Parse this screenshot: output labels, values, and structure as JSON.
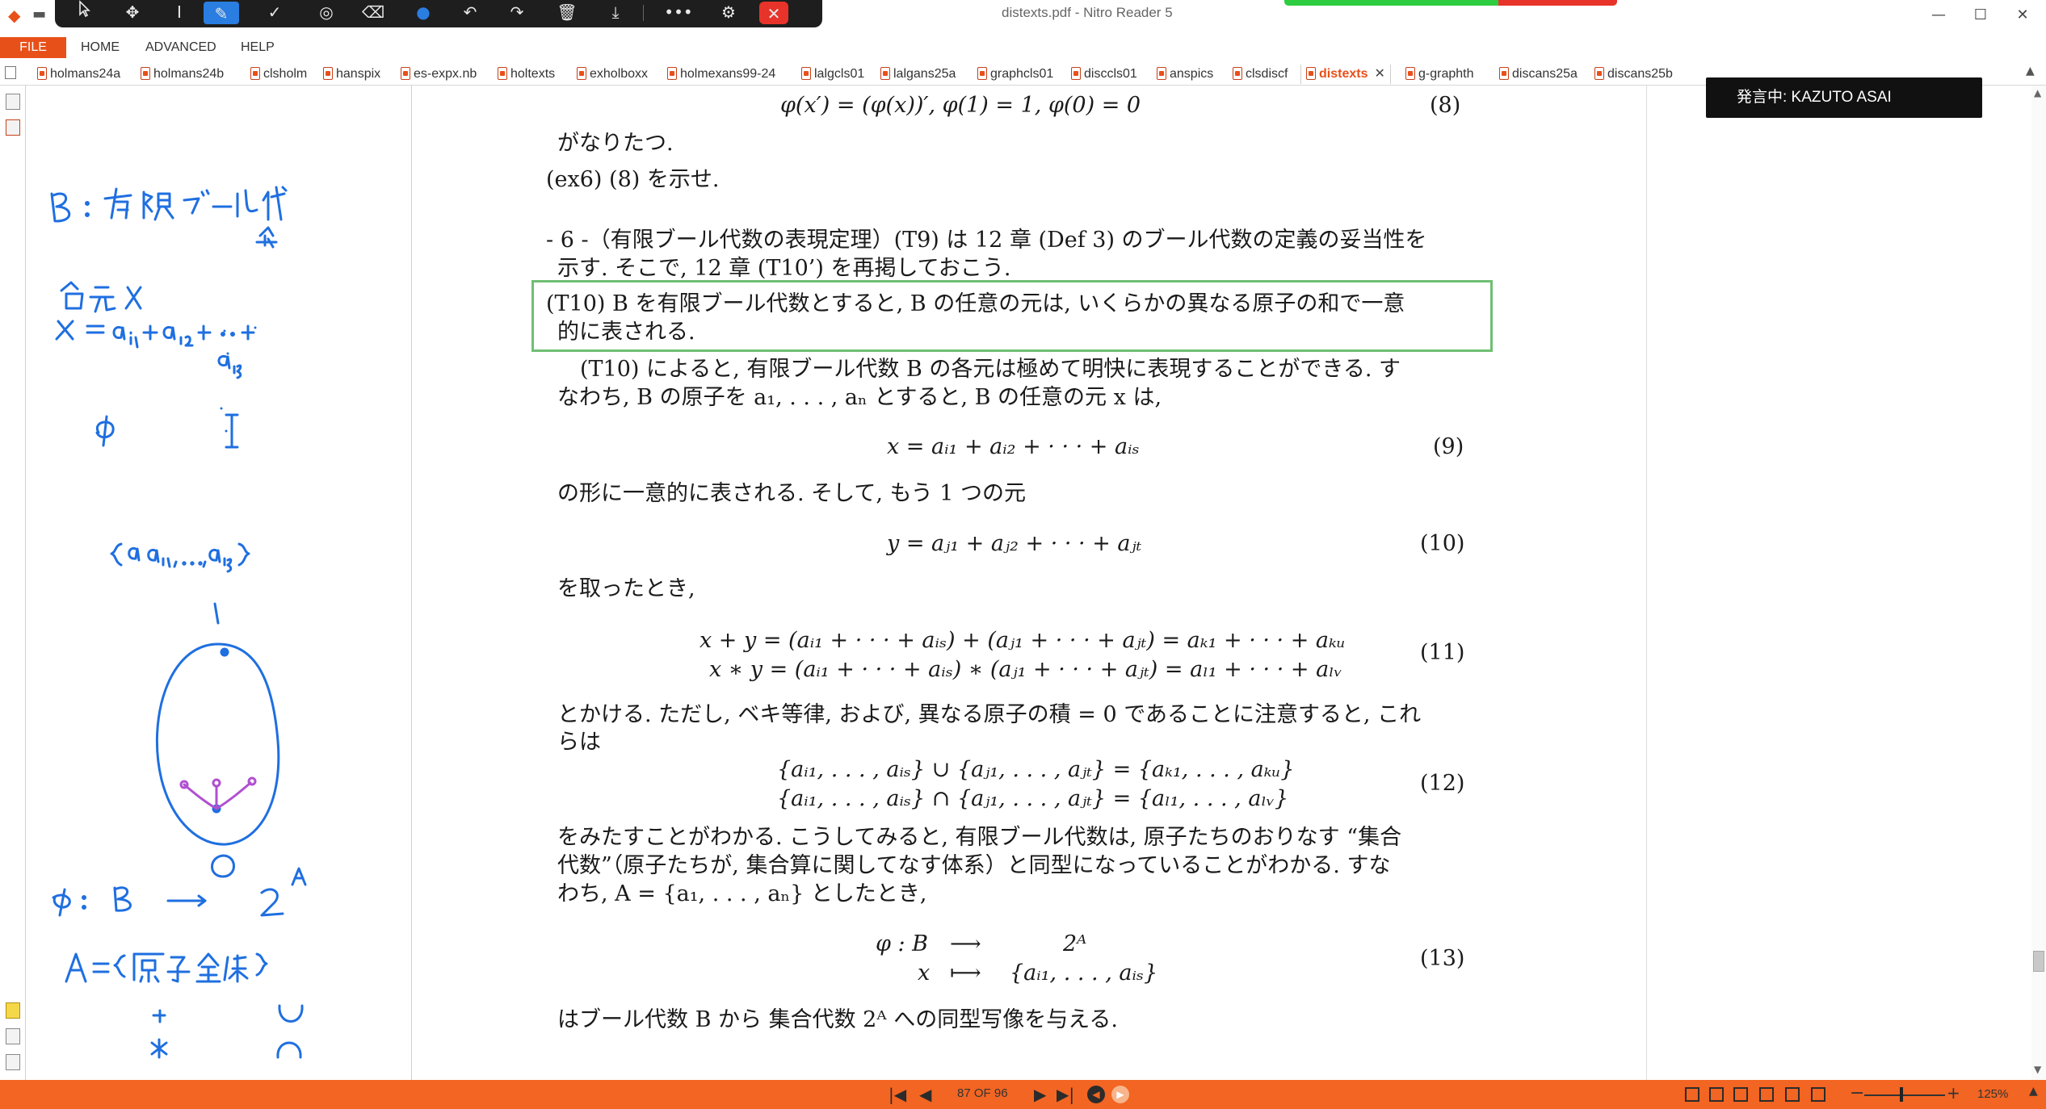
{
  "titlebar": {
    "window_title": "distexts.pdf - Nitro Reader 5",
    "minimize": "—",
    "maximize": "☐",
    "close": "✕"
  },
  "annotation_toolbar": {
    "icons": [
      "arrow-select",
      "move",
      "text-cursor",
      "pen",
      "check",
      "target",
      "eraser",
      "color-dot",
      "undo",
      "redo",
      "trash",
      "download",
      "more",
      "user-settings",
      "close"
    ]
  },
  "ribbon": {
    "file": "FILE",
    "home": "HOME",
    "advanced": "ADVANCED",
    "help": "HELP"
  },
  "doc_tabs": [
    {
      "label": "holmans24a"
    },
    {
      "label": "holmans24b"
    },
    {
      "label": "clsholm"
    },
    {
      "label": "hanspix"
    },
    {
      "label": "es-expx.nb"
    },
    {
      "label": "holtexts"
    },
    {
      "label": "exholboxx"
    },
    {
      "label": "holmexans99-24"
    },
    {
      "label": "lalgcls01"
    },
    {
      "label": "lalgans25a"
    },
    {
      "label": "graphcls01"
    },
    {
      "label": "disccls01"
    },
    {
      "label": "anspics"
    },
    {
      "label": "clsdiscf"
    },
    {
      "label": "distexts",
      "active": true
    },
    {
      "label": "g-graphth"
    },
    {
      "label": "discans25a"
    },
    {
      "label": "discans25b"
    }
  ],
  "speaker_popup": "発言中: KAZUTO ASAI",
  "document": {
    "eq8": "φ(x′) = (φ(x))′,       φ(1) = 1,       φ(0) = 0",
    "eq8_num": "(8)",
    "line_naritatsu": "がなりたつ.",
    "ex6": "(ex6)  (8) を示せ.",
    "sec6_line1": "- 6 -（有限ブール代数の表現定理）(T9) は 12 章 (Def 3) のブール代数の定義の妥当性を",
    "sec6_line2": "示す. そこで, 12 章 (T10’) を再掲しておこう.",
    "t10_line1": "(T10)  B を有限ブール代数とすると, B の任意の元は, いくらかの異なる原子の和で一意",
    "t10_line2": "的に表される.",
    "para1_line1": "(T10) によると, 有限ブール代数 B の各元は極めて明快に表現することができる. す",
    "para1_line2": "なわち, B の原子を  a₁, . . . , aₙ  とすると, B の任意の元 x  は,",
    "eq9": "x = aᵢ₁ + aᵢ₂ + · · · + aᵢₛ",
    "eq9_num": "(9)",
    "line_katachi": "の形に一意的に表される. そして, もう 1 つの元",
    "eq10": "y = aⱼ₁ + aⱼ₂ + · · · + aⱼₜ",
    "eq10_num": "(10)",
    "line_totta": "を取ったとき,",
    "eq11a": "x + y = (aᵢ₁ + · · · + aᵢₛ) + (aⱼ₁ + · · · + aⱼₜ) = aₖ₁ + · · · + aₖᵤ",
    "eq11b": "x ∗ y = (aᵢ₁ + · · · + aᵢₛ) ∗ (aⱼ₁ + · · · + aⱼₜ) = aₗ₁ + · · · + aₗᵥ",
    "eq11_num": "(11)",
    "para2_line1": "とかける. ただし, ベキ等律, および, 異なる原子の積 = 0 であることに注意すると, これ",
    "para2_line2": "らは",
    "eq12a": "{aᵢ₁, . . . , aᵢₛ} ∪ {aⱼ₁, . . . , aⱼₜ} = {aₖ₁, . . . , aₖᵤ}",
    "eq12b": "{aᵢ₁, . . . , aᵢₛ} ∩ {aⱼ₁, . . . , aⱼₜ} = {aₗ₁, . . . , aₗᵥ}",
    "eq12_num": "(12)",
    "para3_line1": "をみたすことがわかる. こうしてみると, 有限ブール代数は, 原子たちのおりなす “集合",
    "para3_line2": "代数”（原子たちが, 集合算に関してなす体系）と同型になっていることがわかる. すな",
    "para3_line3": "わち, A = {a₁, . . . , aₙ} としたとき,",
    "eq13a_left": "φ : B",
    "eq13a_arrow": "⟶",
    "eq13a_right": "2ᴬ",
    "eq13b_left": "x",
    "eq13b_arrow": "⟼",
    "eq13b_right": "{aᵢ₁, . . . , aᵢₛ}",
    "eq13_num": "(13)",
    "last_line": "はブール代数 B から 集合代数 2ᴬ への同型写像を与える."
  },
  "status": {
    "page_indicator": "87 OF 96",
    "zoom": "125%",
    "nav_first": "|◀",
    "nav_prev": "◀",
    "nav_next": "▶",
    "nav_last": "▶|",
    "nav_back": "◀",
    "nav_forward": "▶"
  },
  "colors": {
    "accent": "#f26522",
    "file_tab": "#e8501a",
    "theorem_box": "#6fbf73",
    "ink_blue": "#1f6fe0",
    "ink_purple": "#b050d0"
  }
}
